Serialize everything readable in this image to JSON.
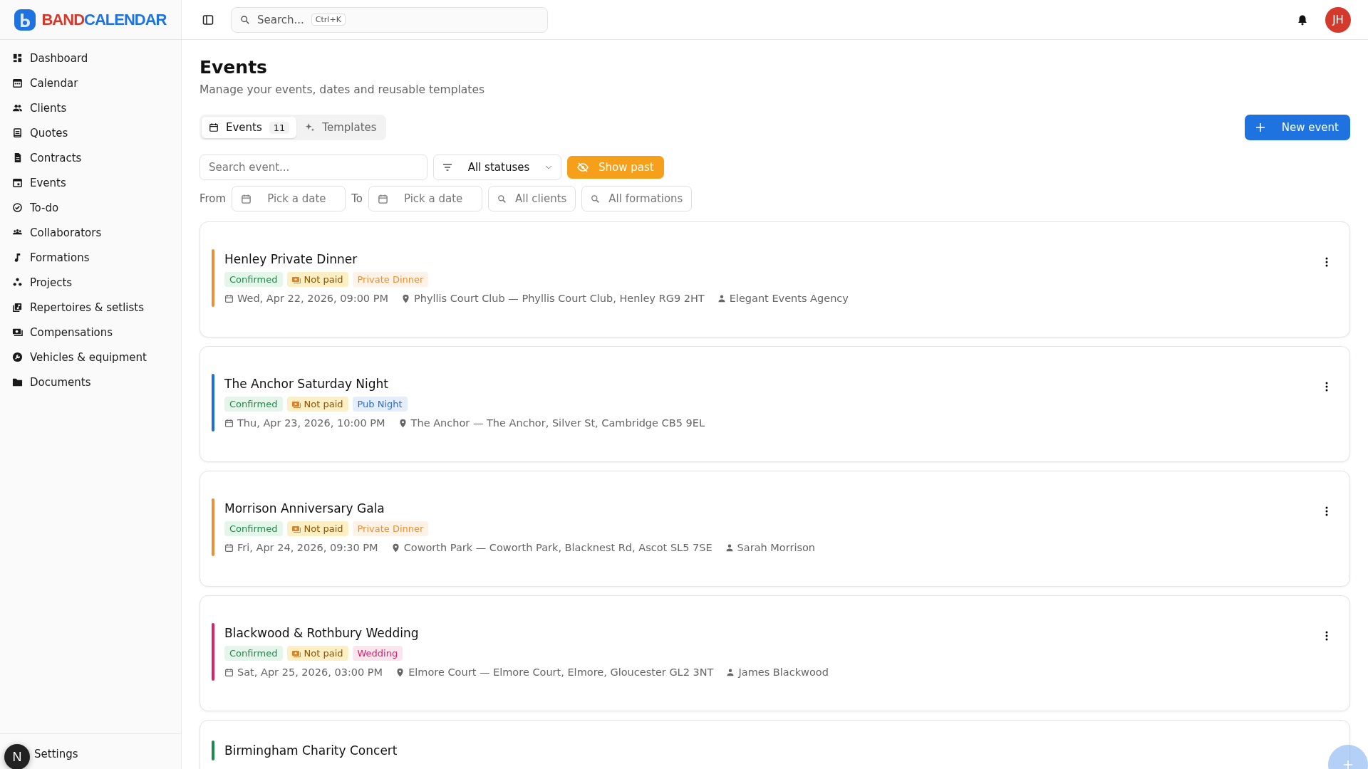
{
  "logo": {
    "part_1": "BAND",
    "part_2": "CALENDAR"
  },
  "header": {
    "search_placeholder": "Search...",
    "shortcut": "Ctrl+K",
    "avatar": "JH"
  },
  "sidebar": {
    "items": [
      {
        "label": "Dashboard"
      },
      {
        "label": "Calendar"
      },
      {
        "label": "Clients"
      },
      {
        "label": "Quotes"
      },
      {
        "label": "Contracts"
      },
      {
        "label": "Events"
      },
      {
        "label": "To-do"
      },
      {
        "label": "Collaborators"
      },
      {
        "label": "Formations"
      },
      {
        "label": "Projects"
      },
      {
        "label": "Repertoires & setlists"
      },
      {
        "label": "Compensations"
      },
      {
        "label": "Vehicles & equipment"
      },
      {
        "label": "Documents"
      }
    ],
    "footer_item": "Settings",
    "dev_badge": "N"
  },
  "page": {
    "title": "Events",
    "subtitle": "Manage your events, dates and reusable templates"
  },
  "tabs": [
    {
      "label": "Events",
      "count": "11",
      "selected": true
    },
    {
      "label": "Templates",
      "selected": false
    }
  ],
  "new_event_button": "New event",
  "filters": {
    "search_placeholder": "Search event...",
    "status": "All statuses",
    "show_past": "Show past",
    "from_label": "From",
    "from_placeholder": "Pick a date",
    "to_label": "To",
    "to_placeholder": "Pick a date",
    "clients": "All clients",
    "formations": "All formations"
  },
  "events": [
    {
      "title": "Henley Private Dinner",
      "color": "#e8913a",
      "tags": [
        {
          "kind": "status",
          "label": "Confirmed"
        },
        {
          "kind": "payment",
          "label": "Not paid"
        },
        {
          "kind": "category",
          "label": "Private Dinner",
          "color": "#e8913a"
        }
      ],
      "date": "Wed, Apr 22, 2026, 09:00 PM",
      "location": "Phyllis Court Club — Phyllis Court Club, Henley RG9 2HT",
      "client": "Elegant Events Agency"
    },
    {
      "title": "The Anchor Saturday Night",
      "color": "#1e6fd9",
      "tags": [
        {
          "kind": "status",
          "label": "Confirmed"
        },
        {
          "kind": "payment",
          "label": "Not paid"
        },
        {
          "kind": "category",
          "label": "Pub Night",
          "color": "#1e6fd9"
        }
      ],
      "date": "Thu, Apr 23, 2026, 10:00 PM",
      "location": "The Anchor — The Anchor, Silver St, Cambridge CB5 9EL"
    },
    {
      "title": "Morrison Anniversary Gala",
      "color": "#e8913a",
      "tags": [
        {
          "kind": "status",
          "label": "Confirmed"
        },
        {
          "kind": "payment",
          "label": "Not paid"
        },
        {
          "kind": "category",
          "label": "Private Dinner",
          "color": "#e8913a"
        }
      ],
      "date": "Fri, Apr 24, 2026, 09:30 PM",
      "location": "Coworth Park — Coworth Park, Blacknest Rd, Ascot SL5 7SE",
      "client": "Sarah Morrison"
    },
    {
      "title": "Blackwood & Rothbury Wedding",
      "color": "#d6246e",
      "tags": [
        {
          "kind": "status",
          "label": "Confirmed"
        },
        {
          "kind": "payment",
          "label": "Not paid"
        },
        {
          "kind": "category",
          "label": "Wedding",
          "color": "#d6246e"
        }
      ],
      "date": "Sat, Apr 25, 2026, 03:00 PM",
      "location": "Elmore Court — Elmore Court, Elmore, Gloucester GL2 3NT",
      "client": "James Blackwood"
    },
    {
      "title": "Birmingham Charity Concert",
      "color": "#1f8a4c"
    }
  ]
}
